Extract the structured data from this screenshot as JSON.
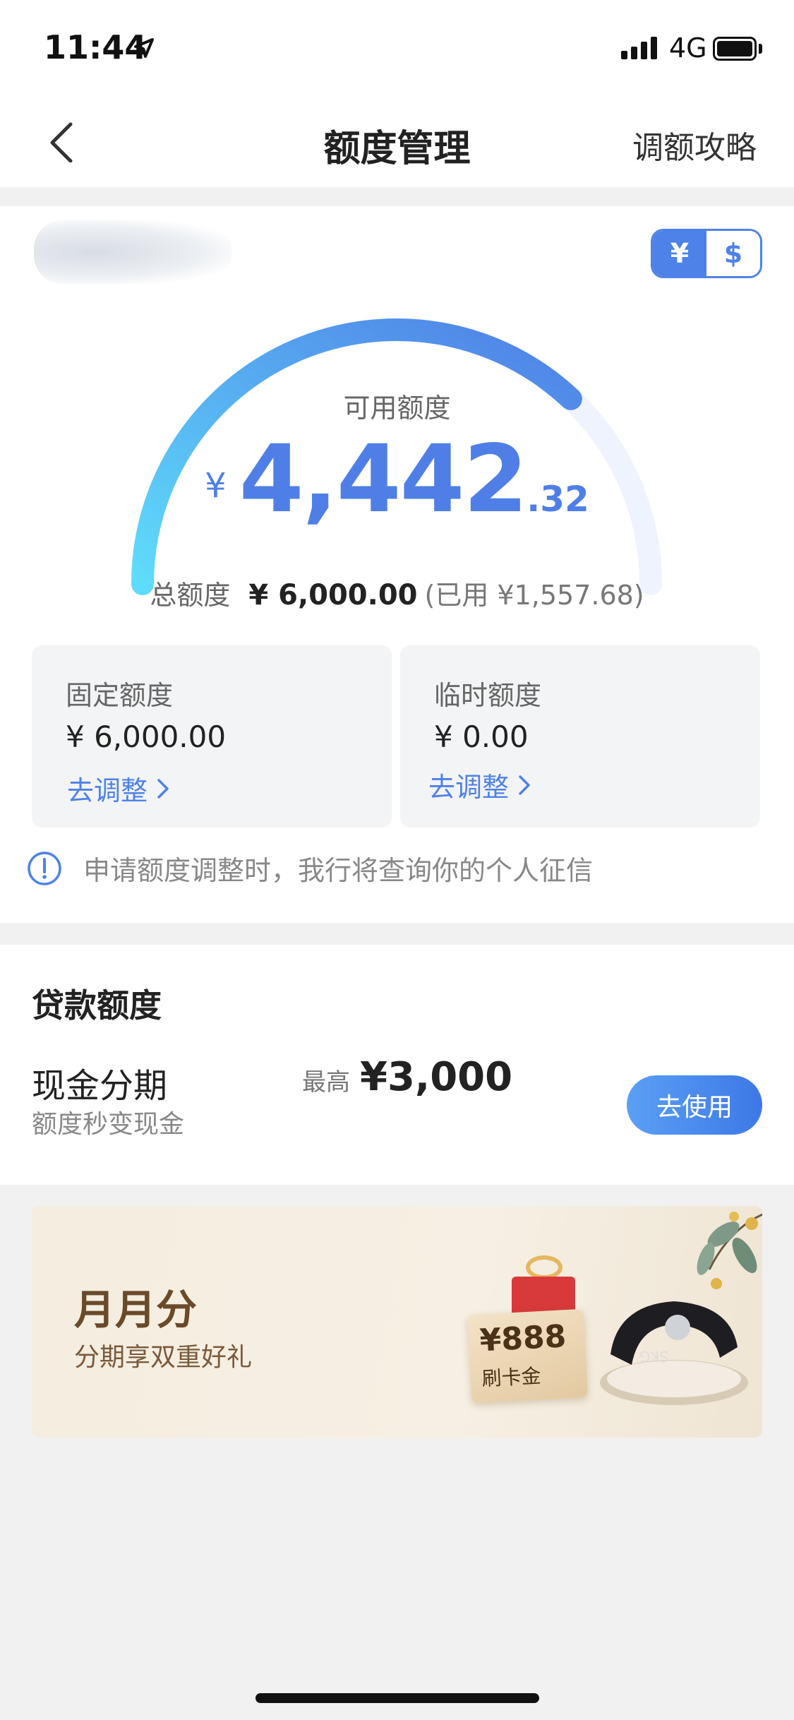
{
  "status_bar": {
    "time": "11:44",
    "network": "4G"
  },
  "nav": {
    "title": "额度管理",
    "right_link": "调额攻略"
  },
  "currency_toggle": {
    "options": [
      "¥",
      "$"
    ],
    "selected": "¥"
  },
  "credit": {
    "available_label": "可用额度",
    "available_symbol": "¥",
    "available_integer": "4,442",
    "available_decimal": ".32",
    "available_fraction_of_total": 0.7404,
    "total_label": "总额度",
    "total_value": "¥ 6,000.00",
    "used_text": "(已用 ¥1,557.68)"
  },
  "fixed_quota": {
    "title": "固定额度",
    "value": "¥ 6,000.00",
    "link": "去调整"
  },
  "temp_quota": {
    "title": "临时额度",
    "value": "¥ 0.00",
    "link": "去调整"
  },
  "notice": {
    "text": "申请额度调整时，我行将查询你的个人征信"
  },
  "loan": {
    "section_title": "贷款额度",
    "product_name": "现金分期",
    "product_subtitle": "额度秒变现金",
    "max_label": "最高",
    "max_value": "¥3,000",
    "button_label": "去使用"
  },
  "banner": {
    "title": "月月分",
    "subtitle": "分期享双重好礼",
    "tag_amount": "¥888",
    "tag_subtitle": "刷卡金",
    "device_text": "SKG"
  },
  "colors": {
    "accent": "#4f82e8",
    "gauge_start": "#5fdcfb",
    "gauge_end": "#4f7fe6"
  }
}
